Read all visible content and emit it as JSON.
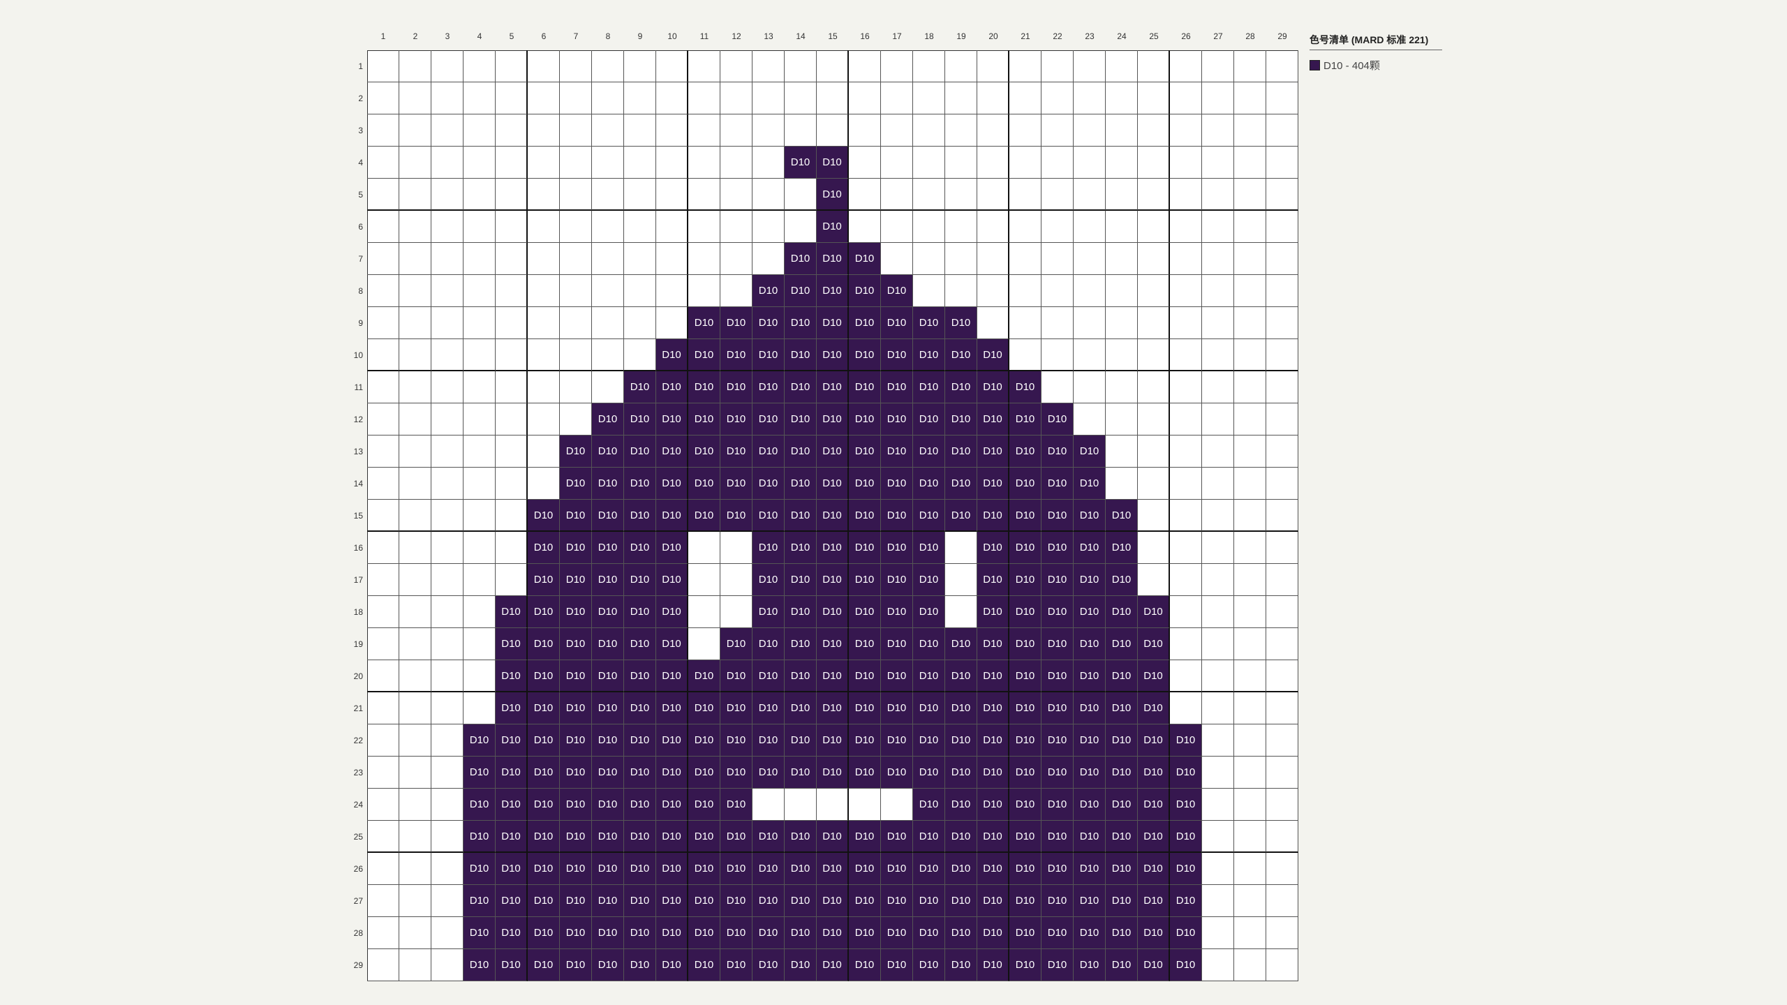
{
  "legend": {
    "title": "色号清单 (MARD 标准 221)",
    "items": [
      {
        "code": "D10",
        "label": "D10 - 404颗",
        "color": "#36174f"
      }
    ]
  },
  "grid": {
    "cols": 29,
    "rows": 29,
    "col_numbers": [
      "1",
      "2",
      "3",
      "4",
      "5",
      "6",
      "7",
      "8",
      "9",
      "10",
      "11",
      "12",
      "13",
      "14",
      "15",
      "16",
      "17",
      "18",
      "19",
      "20",
      "21",
      "22",
      "23",
      "24",
      "25",
      "26",
      "27",
      "28",
      "29"
    ],
    "row_numbers": [
      "1",
      "2",
      "3",
      "4",
      "5",
      "6",
      "7",
      "8",
      "9",
      "10",
      "11",
      "12",
      "13",
      "14",
      "15",
      "16",
      "17",
      "18",
      "19",
      "20",
      "21",
      "22",
      "23",
      "24",
      "25",
      "26",
      "27",
      "28",
      "29"
    ],
    "major_every": 5,
    "filled_color": "#36174f",
    "filled_code": "D10",
    "pattern": [
      ".............................",
      ".............................",
      ".............................",
      ".............XX..............",
      "..............X..............",
      "..............X..............",
      ".............XXX.............",
      "............XXXXX............",
      "..........XXXXXXXXX..........",
      ".........XXXXXXXXXXX.........",
      "........XXXXXXXXXXXXX........",
      ".......XXXXXXXXXXXXXXX.......",
      "......XXXXXXXXXXXXXXXXX......",
      "......XXXXXXXXXXXXXXXXX......",
      ".....XXXXXXXXXXXXXXXXXXX.....",
      ".....XXXXX..XXXXXX.XXXXX.....",
      ".....XXXXX..XXXXXX.XXXXX.....",
      "....XXXXXX..XXXXXX.XXXXXX....",
      "....XXXXXX.XXXXXXXXXXXXXX....",
      "....XXXXXXXXXXXXXXXXXXXXX....",
      "....XXXXXXXXXXXXXXXXXXXXX....",
      "...XXXXXXXXXXXXXXXXXXXXXXX...",
      "...XXXXXXXXXXXXXXXXXXXXXXX...",
      "...XXXXXXXXX.....XXXXXXXXX...",
      "...XXXXXXXXXXXXXXXXXXXXXXX...",
      "...XXXXXXXXXXXXXXXXXXXXXXX...",
      "...XXXXXXXXXXXXXXXXXXXXXXX...",
      "...XXXXXXXXXXXXXXXXXXXXXXX...",
      "...XXXXXXXXXXXXXXXXXXXXXXX..."
    ]
  }
}
